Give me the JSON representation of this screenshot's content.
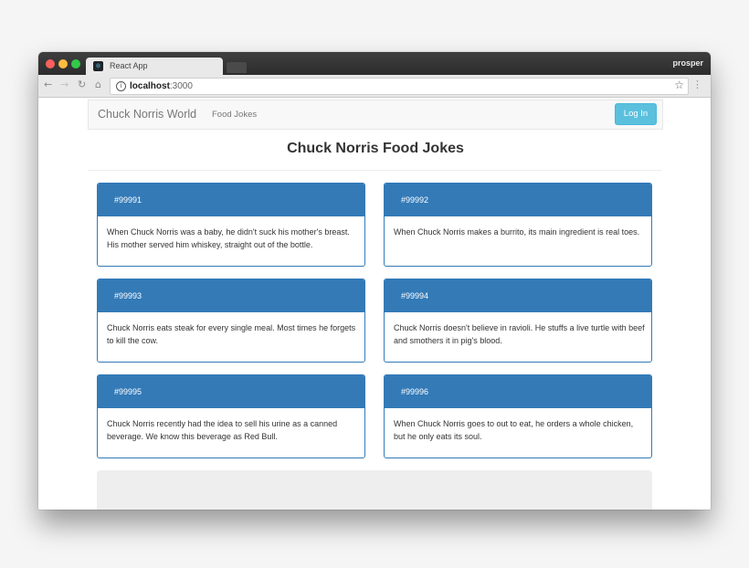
{
  "browser": {
    "tab_title": "React App",
    "profile_name": "prosper",
    "url_host": "localhost",
    "url_port": ":3000",
    "icons": {
      "back": "back-arrow-icon",
      "forward": "forward-arrow-icon",
      "reload": "reload-icon",
      "home": "home-icon",
      "info": "info-icon",
      "star": "star-icon",
      "menu": "kebab-menu-icon"
    }
  },
  "navbar": {
    "brand": "Chuck Norris World",
    "link": "Food Jokes",
    "login_label": "Log In"
  },
  "main": {
    "title": "Chuck Norris Food Jokes",
    "jokes": [
      {
        "id": "#99991",
        "text": "When Chuck Norris was a baby, he didn't suck his mother's breast. His mother served him whiskey, straight out of the bottle."
      },
      {
        "id": "#99992",
        "text": "When Chuck Norris makes a burrito, its main ingredient is real toes."
      },
      {
        "id": "#99993",
        "text": "Chuck Norris eats steak for every single meal. Most times he forgets to kill the cow."
      },
      {
        "id": "#99994",
        "text": "Chuck Norris doesn't believe in ravioli. He stuffs a live turtle with beef and smothers it in pig's blood."
      },
      {
        "id": "#99995",
        "text": "Chuck Norris recently had the idea to sell his urine as a canned beverage. We know this beverage as Red Bull."
      },
      {
        "id": "#99996",
        "text": "When Chuck Norris goes to out to eat, he orders a whole chicken, but he only eats its soul."
      }
    ]
  },
  "colors": {
    "card_header": "#337ab7",
    "login_button": "#5bc0de",
    "navbar_bg": "#f8f8f8"
  }
}
